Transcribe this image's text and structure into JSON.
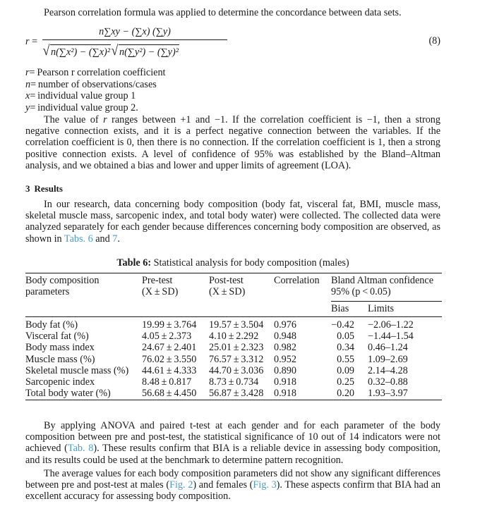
{
  "intro": "Pearson correlation formula was applied to determine the concordance between data sets.",
  "equation": {
    "lhs": "r",
    "equals": "=",
    "numerator": "n∑xy − (∑x) (∑y)",
    "den_left_radicand": "n(∑x²) − (∑x)²",
    "den_right_radicand": "n(∑y²) − (∑y)²",
    "number": "(8)"
  },
  "definitions": [
    {
      "symbol": "r",
      "text": "= Pearson r correlation coefficient"
    },
    {
      "symbol": "n",
      "text": "= number of observations/cases"
    },
    {
      "symbol": "x",
      "text": "= individual value group 1"
    },
    {
      "symbol": "y",
      "text": "= individual value group 2."
    }
  ],
  "r_paragraph": {
    "part1": "The value of ",
    "symbol": "r",
    "part2": " ranges between +1 and −1. If the correlation coefficient is −1, then a strong negative connection exists, and it is a perfect negative connection between the variables. If the correlation coefficient is 0, then there is no connection. If the correlation coefficient is 1, then a strong positive connection exists. A level of confidence of 95% was established by the Bland–Altman analysis, and we obtained a bias and lower and upper limits of agreement (LOA)."
  },
  "results_heading": {
    "number": "3",
    "title": "Results"
  },
  "results_paragraph": {
    "text": "In our research, data concerning body composition (body fat, visceral fat, BMI, muscle mass, skeletal muscle mass, sarcopenic index, and total body water) were collected. The collected data were analyzed separately for each gender because differences concerning body composition are observed, as shown in ",
    "link1": "Tabs. 6",
    "mid": " and ",
    "link2": "7",
    "end": "."
  },
  "table": {
    "caption_label": "Table 6:",
    "caption_text": " Statistical analysis for body composition (males)",
    "headers": {
      "param_line1": "Body composition",
      "param_line2": "parameters",
      "pre_line1": "Pre-test",
      "pre_line2": "(X ± SD)",
      "post_line1": "Post-test",
      "post_line2": "(X ± SD)",
      "correlation": "Correlation",
      "bland_line1": "Bland Altman confidence",
      "bland_line2": "95% (p < 0.05)",
      "bias": "Bias",
      "limits": "Limits"
    },
    "rows": [
      {
        "param": "Body fat (%)",
        "pre": "19.99 ± 3.764",
        "post": "19.57 ± 3.504",
        "corr": "0.976",
        "bias": "−0.42",
        "limits": "−2.06–1.22"
      },
      {
        "param": "Visceral fat (%)",
        "pre": "4.05 ± 2.373",
        "post": "4.10 ± 2.292",
        "corr": "0.948",
        "bias": "0.05",
        "limits": "−1.44–1.54"
      },
      {
        "param": "Body mass index",
        "pre": "24.67 ± 2.401",
        "post": "25.01 ± 2.323",
        "corr": "0.982",
        "bias": "0.34",
        "limits": "0.46–1.24"
      },
      {
        "param": "Muscle mass (%)",
        "pre": "76.02 ± 3.550",
        "post": "76.57 ± 3.312",
        "corr": "0.952",
        "bias": "0.55",
        "limits": "1.09–2.69"
      },
      {
        "param": "Skeletal muscle mass (%)",
        "pre": "44.61 ± 4.333",
        "post": "44.70 ± 3.036",
        "corr": "0.890",
        "bias": "0.09",
        "limits": "2.14–4.28"
      },
      {
        "param": "Sarcopenic index",
        "pre": "8.48 ± 0.817",
        "post": "8.73 ± 0.734",
        "corr": "0.918",
        "bias": "0.25",
        "limits": "0.32–0.88"
      },
      {
        "param": "Total body water (%)",
        "pre": "56.68 ± 4.450",
        "post": "56.87 ± 3.428",
        "corr": "0.918",
        "bias": "0.20",
        "limits": "1.93–3.97"
      }
    ]
  },
  "anova_paragraph": {
    "text": "By applying ANOVA and paired t-test at each gender and for each parameter of the body composition between pre and post-test, the statistical significance of 10 out of 14 indicators were not achieved (",
    "link": "Tab. 8",
    "end": "). These results confirm that BIA is a reliable device in assessing body composition, and its results could be used at the benchmark to determine pattern recognition."
  },
  "average_paragraph": {
    "text": "The average values for each body composition parameters did not show any significant differences between pre and post-test at males (",
    "link1": "Fig. 2",
    "mid": ") and females (",
    "link2": "Fig. 3",
    "end": "). These aspects confirm that BIA had an excellent accuracy for assessing body composition."
  },
  "colors": {
    "link": "#4a9cc8",
    "text": "#1a1a1a",
    "background": "#ffffff"
  }
}
